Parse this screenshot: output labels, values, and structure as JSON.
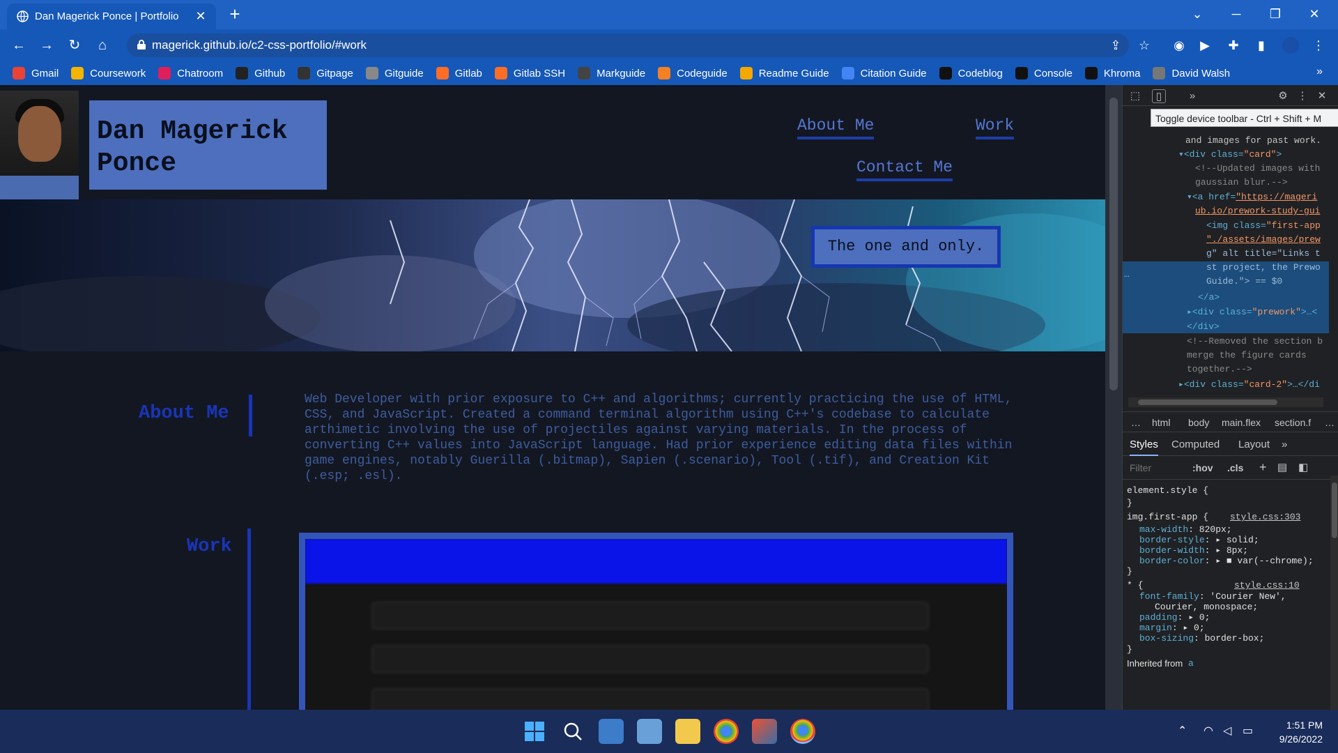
{
  "browser": {
    "tab_title": "Dan Magerick Ponce | Portfolio",
    "url": "magerick.github.io/c2-css-portfolio/#work",
    "window_chevron": "⌄",
    "new_tab": "+",
    "tab_close": "✕"
  },
  "bookmarks": [
    {
      "label": "Gmail",
      "icon": "google-icon",
      "color": "#ea4335"
    },
    {
      "label": "Coursework",
      "icon": "course-icon",
      "color": "#f4b400"
    },
    {
      "label": "Chatroom",
      "icon": "slack-icon",
      "color": "#e01e5a"
    },
    {
      "label": "Github",
      "icon": "github-icon",
      "color": "#222222"
    },
    {
      "label": "Gitpage",
      "icon": "github-icon",
      "color": "#333333"
    },
    {
      "label": "Gitguide",
      "icon": "globe-icon",
      "color": "#888888"
    },
    {
      "label": "Gitlab",
      "icon": "gitlab-icon",
      "color": "#fc6d26"
    },
    {
      "label": "Gitlab SSH",
      "icon": "gitlab-icon",
      "color": "#fc6d26"
    },
    {
      "label": "Markguide",
      "icon": "markdown-icon",
      "color": "#444444"
    },
    {
      "label": "Codeguide",
      "icon": "stack-icon",
      "color": "#f48024"
    },
    {
      "label": "Readme Guide",
      "icon": "fs-icon",
      "color": "#f5a800"
    },
    {
      "label": "Citation Guide",
      "icon": "google-icon",
      "color": "#4285f4"
    },
    {
      "label": "Codeblog",
      "icon": "dev-icon",
      "color": "#111111"
    },
    {
      "label": "Console",
      "icon": "console-icon",
      "color": "#111111"
    },
    {
      "label": "Khroma",
      "icon": "khroma-icon",
      "color": "#111111"
    },
    {
      "label": "David Walsh",
      "icon": "walsh-icon",
      "color": "#777777"
    }
  ],
  "bookmarks_more": "»",
  "page": {
    "name": "Dan Magerick Ponce",
    "nav": {
      "about": "About Me",
      "work": "Work",
      "contact": "Contact Me"
    },
    "tagline": "The one and only.",
    "about_heading": "About Me",
    "about_text": "Web Developer with prior exposure to C++ and algorithms; currently practicing the use of HTML, CSS, and JavaScript. Created a command terminal algorithm using C++'s codebase to calculate arthimetic involving the use of projectiles against varying materials. In the process of converting C++ values into JavaScript language. Had prior experience editing data files within game engines, notably Guerilla (.bitmap), Sapien (.scenario), Tool (.tif), and Creation Kit (.esp; .esl).",
    "work_heading": "Work"
  },
  "devtools": {
    "tooltip": "Toggle device toolbar - Ctrl + Shift + M",
    "more_tools": "»",
    "dom": {
      "l1": "and images for past work.",
      "l2_tag": "<div class=",
      "l2_val": "\"card\"",
      "l2_end": ">",
      "l3": "<!--Updated images with",
      "l4": "gaussian blur.-->",
      "l5_tag": "<a href=",
      "l5_val": "\"https://mageri",
      "l6_val": "ub.io/prework-study-gui",
      "l7_tag": "<img class=",
      "l7_val": "\"first-app",
      "l8_val": "\"./assets/images/prew",
      "l9": "g\" alt title=\"Links t",
      "l10": "st project, the Prewo",
      "l11": "Guide.\"> == $0",
      "l12": "</a>",
      "l13_tag": "<div class=",
      "l13_val": "\"prework\"",
      "l13_end": ">…<",
      "l14": "</div>",
      "l15": "<!--Removed the section b",
      "l16": "merge the figure cards",
      "l17": "together.-->",
      "l18_tag": "<div class=",
      "l18_val": "\"card-2\"",
      "l18_end": ">…</di",
      "ellipsis": "…"
    },
    "crumbs": [
      "…",
      "html",
      "body",
      "main.flex",
      "section.f",
      "…"
    ],
    "style_tabs": [
      "Styles",
      "Computed",
      "Layout",
      "»"
    ],
    "filter_placeholder": "Filter",
    "hov": ":hov",
    "cls": ".cls",
    "styles": {
      "element_style": "element.style {",
      "close": "}",
      "rule1_selector": "img.first-app {",
      "rule1_source": "style.css:303",
      "rule1_props": [
        {
          "name": "max-width",
          "value": "820px;"
        },
        {
          "name": "border-style",
          "value": "▸ solid;"
        },
        {
          "name": "border-width",
          "value": "▸ 8px;"
        },
        {
          "name": "border-color",
          "value": "▸ ■ var(--chrome);"
        }
      ],
      "rule2_selector": "* {",
      "rule2_source": "style.css:10",
      "rule2_props": [
        {
          "name": "font-family",
          "value": "'Courier New',"
        },
        {
          "name": "",
          "value": "Courier, monospace;"
        },
        {
          "name": "padding",
          "value": "▸ 0;"
        },
        {
          "name": "margin",
          "value": "▸ 0;"
        },
        {
          "name": "box-sizing",
          "value": "border-box;"
        }
      ],
      "inherited": "Inherited from",
      "inherited_el": "a"
    }
  },
  "taskbar": {
    "time": "1:51 PM",
    "date": "9/26/2022"
  },
  "colors": {
    "chrome_blue": "#1558b8",
    "page_bg": "#131722",
    "accent": "#4d6fbd",
    "dark_blue": "#1a35b8"
  }
}
